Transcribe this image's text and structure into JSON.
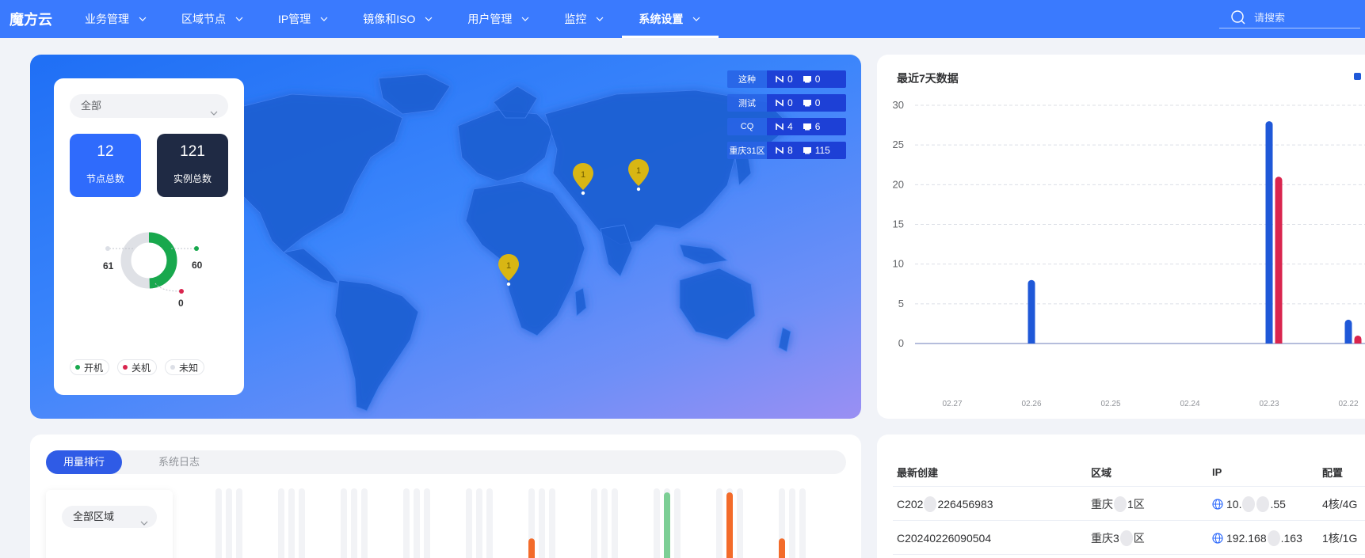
{
  "app": {
    "logo": "魔方云"
  },
  "nav": {
    "items": [
      {
        "label": "业务管理"
      },
      {
        "label": "区域节点"
      },
      {
        "label": "IP管理"
      },
      {
        "label": "镜像和ISO"
      },
      {
        "label": "用户管理"
      },
      {
        "label": "监控"
      },
      {
        "label": "系统设置"
      }
    ],
    "active": "系统设置",
    "search_placeholder": "请搜索"
  },
  "overview": {
    "filter_value": "全部",
    "nodes_total": {
      "value": "12",
      "label": "节点总数"
    },
    "instances_total": {
      "value": "121",
      "label": "实例总数"
    },
    "status": {
      "off_count": "61",
      "on_count": "60",
      "unknown_count": "0"
    },
    "legend": [
      {
        "label": "开机",
        "color": "#18a84d"
      },
      {
        "label": "关机",
        "color": "#d9254e"
      },
      {
        "label": "未知",
        "color": "#dcdfe6"
      }
    ],
    "colors": {
      "on": "#18a84d",
      "off": "#dfe1e6",
      "unknown": "#d9254e"
    }
  },
  "regions": [
    {
      "name": "这种",
      "nodes": "0",
      "instances": "0"
    },
    {
      "name": "测试",
      "nodes": "0",
      "instances": "0"
    },
    {
      "name": "CQ",
      "nodes": "4",
      "instances": "6"
    },
    {
      "name": "重庆31区",
      "nodes": "8",
      "instances": "115"
    }
  ],
  "map_pins": [
    "1",
    "1",
    "1"
  ],
  "chart": {
    "title": "最近7天数据"
  },
  "chart_data": {
    "type": "bar",
    "title": "最近7天数据",
    "categories": [
      "02.27",
      "02.26",
      "02.25",
      "02.24",
      "02.23",
      "02.22"
    ],
    "series": [
      {
        "color": "#1f58d8",
        "values": [
          0,
          8,
          0,
          0,
          28,
          3
        ]
      },
      {
        "color": "#d9254e",
        "values": [
          0,
          0,
          0,
          0,
          21,
          1
        ]
      }
    ],
    "ylim": [
      0,
      30
    ],
    "yticks": [
      "0",
      "5",
      "10",
      "15",
      "20",
      "25",
      "30"
    ],
    "grid": true
  },
  "usage": {
    "tabs": [
      {
        "label": "用量排行"
      },
      {
        "label": "系统日志"
      }
    ],
    "region_filter": "全部区域",
    "bar_colors": {
      "track": "#f2f3f6",
      "orange": "#f36b2a",
      "green": "#7dcf95"
    },
    "bars": [
      {
        "values": [
          0,
          0,
          0
        ]
      },
      {
        "values": [
          0,
          0,
          0
        ]
      },
      {
        "values": [
          0,
          0,
          0
        ]
      },
      {
        "values": [
          0,
          0,
          0
        ]
      },
      {
        "values": [
          0,
          0,
          0
        ]
      },
      {
        "values": [
          0.38,
          0,
          0
        ]
      },
      {
        "values": [
          0,
          0,
          0
        ]
      },
      {
        "values": [
          0,
          0.95,
          0
        ]
      },
      {
        "values": [
          0,
          0.95,
          0
        ]
      },
      {
        "values": [
          0.38,
          0,
          0
        ]
      }
    ]
  },
  "recent": {
    "headers": [
      "最新创建",
      "区域",
      "IP",
      "配置"
    ],
    "rows": [
      {
        "name_a": "C202",
        "name_b": "226456983",
        "region_a": "重庆",
        "region_b": "1区",
        "ip_a": "10.",
        "ip_b": ".55",
        "config": "4核/4G"
      },
      {
        "name_a": "C20240226090504",
        "name_b": "",
        "region_a": "重庆3",
        "region_b": "区",
        "ip_a": "192.168",
        "ip_b": ".163",
        "config": "1核/1G"
      }
    ]
  }
}
